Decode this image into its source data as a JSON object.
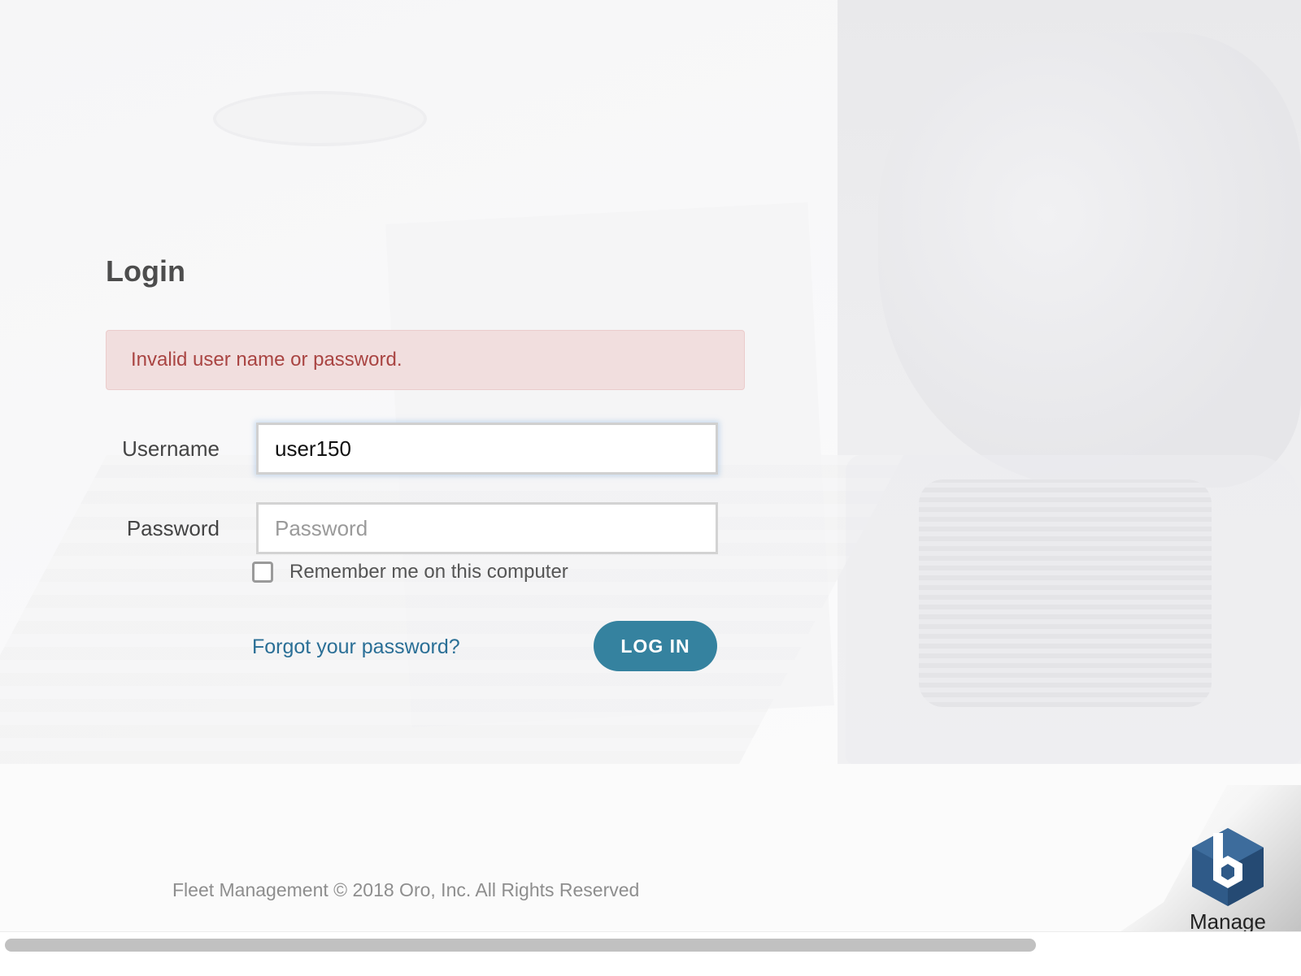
{
  "login": {
    "title": "Login",
    "error_message": "Invalid user name or password.",
    "username_label": "Username",
    "username_value": "user150",
    "password_label": "Password",
    "password_placeholder": "Password",
    "remember_label": "Remember me on this computer",
    "remember_checked": false,
    "forgot_link": "Forgot your password?",
    "login_button": "LOG IN"
  },
  "footer": {
    "text": "Fleet Management © 2018 Oro, Inc. All Rights Reserved"
  },
  "brand": {
    "label": "Manage",
    "icon": "hexagon-b-logo-icon"
  },
  "colors": {
    "accent": "#35829f",
    "link": "#2a6f96",
    "error_text": "#a94442",
    "error_bg": "#f1dede"
  }
}
